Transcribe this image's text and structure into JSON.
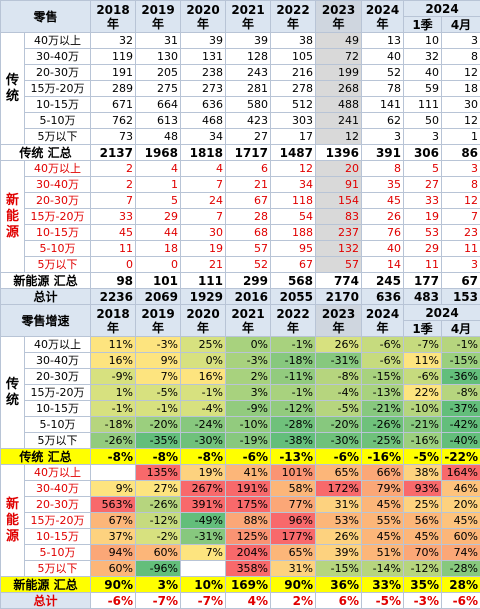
{
  "retail": {
    "header": {
      "label": "零售",
      "years": [
        "2018年",
        "2019年",
        "2020年",
        "2021年",
        "2022年",
        "2023年",
        "2024年"
      ],
      "group2024": "2024",
      "sub": [
        "1季",
        "4月"
      ]
    },
    "traditional": {
      "group_label": "传统",
      "rows": [
        {
          "label": "40万以上",
          "values": [
            "32",
            "31",
            "39",
            "39",
            "38",
            "49",
            "13",
            "10",
            "3"
          ]
        },
        {
          "label": "30-40万",
          "values": [
            "119",
            "130",
            "131",
            "128",
            "105",
            "72",
            "40",
            "32",
            "8"
          ]
        },
        {
          "label": "20-30万",
          "values": [
            "191",
            "205",
            "238",
            "243",
            "216",
            "199",
            "52",
            "40",
            "12"
          ]
        },
        {
          "label": "15万-20万",
          "values": [
            "289",
            "275",
            "273",
            "281",
            "278",
            "268",
            "78",
            "59",
            "18"
          ]
        },
        {
          "label": "10-15万",
          "values": [
            "671",
            "664",
            "636",
            "580",
            "512",
            "488",
            "141",
            "111",
            "30"
          ]
        },
        {
          "label": "5-10万",
          "values": [
            "762",
            "613",
            "468",
            "423",
            "303",
            "241",
            "62",
            "50",
            "12"
          ]
        },
        {
          "label": "5万以下",
          "values": [
            "73",
            "48",
            "34",
            "27",
            "17",
            "12",
            "3",
            "3",
            "1"
          ]
        }
      ],
      "sum": {
        "label": "传统 汇总",
        "values": [
          "2137",
          "1968",
          "1818",
          "1717",
          "1487",
          "1396",
          "391",
          "306",
          "86"
        ]
      }
    },
    "nev": {
      "group_label": "新能源",
      "rows": [
        {
          "label": "40万以上",
          "values": [
            "2",
            "4",
            "4",
            "6",
            "12",
            "20",
            "8",
            "5",
            "3"
          ]
        },
        {
          "label": "30-40万",
          "values": [
            "2",
            "1",
            "7",
            "21",
            "34",
            "91",
            "35",
            "27",
            "8"
          ]
        },
        {
          "label": "20-30万",
          "values": [
            "7",
            "5",
            "24",
            "67",
            "118",
            "154",
            "45",
            "33",
            "12"
          ]
        },
        {
          "label": "15万-20万",
          "values": [
            "33",
            "29",
            "7",
            "28",
            "54",
            "83",
            "26",
            "19",
            "7"
          ]
        },
        {
          "label": "10-15万",
          "values": [
            "45",
            "44",
            "30",
            "68",
            "188",
            "237",
            "76",
            "53",
            "23"
          ]
        },
        {
          "label": "5-10万",
          "values": [
            "11",
            "18",
            "19",
            "57",
            "95",
            "132",
            "40",
            "29",
            "11"
          ]
        },
        {
          "label": "5万以下",
          "values": [
            "0",
            "0",
            "21",
            "52",
            "67",
            "57",
            "14",
            "11",
            "3"
          ]
        }
      ],
      "sum": {
        "label": "新能源 汇总",
        "values": [
          "98",
          "101",
          "111",
          "299",
          "568",
          "774",
          "245",
          "177",
          "67"
        ]
      }
    },
    "total": {
      "label": "总计",
      "values": [
        "2236",
        "2069",
        "1929",
        "2016",
        "2055",
        "2170",
        "636",
        "483",
        "153"
      ]
    }
  },
  "growth": {
    "header": {
      "label": "零售增速",
      "years": [
        "2018年",
        "2019年",
        "2020年",
        "2021年",
        "2022年",
        "2023年",
        "2024年"
      ],
      "group2024": "2024",
      "sub": [
        "1季",
        "4月"
      ]
    },
    "traditional": {
      "group_label": "传统",
      "rows": [
        {
          "label": "40万以上",
          "values": [
            "11%",
            "-3%",
            "25%",
            "0%",
            "-1%",
            "26%",
            "-6%",
            "-7%",
            "-1%"
          ],
          "colors": [
            "#fde47f",
            "#fde47f",
            "#d7e17f",
            "#a8d27e",
            "#a8d27e",
            "#d7e17f",
            "#c6db7e",
            "#c6db7e",
            "#b6d57e"
          ]
        },
        {
          "label": "30-40万",
          "values": [
            "16%",
            "9%",
            "0%",
            "-3%",
            "-18%",
            "-31%",
            "-6%",
            "11%",
            "-15%"
          ],
          "colors": [
            "#fde47f",
            "#fde47f",
            "#d7e17f",
            "#a8d27e",
            "#87c87e",
            "#87c87e",
            "#c6db7e",
            "#fde47f",
            "#9bcf7e"
          ]
        },
        {
          "label": "20-30万",
          "values": [
            "-9%",
            "7%",
            "16%",
            "2%",
            "-11%",
            "-8%",
            "-15%",
            "-6%",
            "-36%"
          ],
          "colors": [
            "#d7e17f",
            "#fde47f",
            "#fde47f",
            "#a8d27e",
            "#92cb7e",
            "#b6d57e",
            "#a8d27e",
            "#c6db7e",
            "#63be7b"
          ]
        },
        {
          "label": "15万-20万",
          "values": [
            "1%",
            "-5%",
            "-1%",
            "3%",
            "-1%",
            "-4%",
            "-13%",
            "22%",
            "-8%"
          ],
          "colors": [
            "#d7e17f",
            "#d7e17f",
            "#d7e17f",
            "#a8d27e",
            "#a8d27e",
            "#b6d57e",
            "#a8d27e",
            "#fde47f",
            "#b6d57e"
          ]
        },
        {
          "label": "10-15万",
          "values": [
            "-1%",
            "-1%",
            "-4%",
            "-9%",
            "-12%",
            "-5%",
            "-21%",
            "-10%",
            "-37%"
          ],
          "colors": [
            "#d7e17f",
            "#d7e17f",
            "#d7e17f",
            "#92cb7e",
            "#92cb7e",
            "#b6d57e",
            "#87c87e",
            "#b6d57e",
            "#63be7b"
          ]
        },
        {
          "label": "5-10万",
          "values": [
            "-18%",
            "-20%",
            "-24%",
            "-10%",
            "-28%",
            "-20%",
            "-26%",
            "-21%",
            "-42%"
          ],
          "colors": [
            "#b6d57e",
            "#9bcf7e",
            "#87c87e",
            "#92cb7e",
            "#6fc17b",
            "#87c87e",
            "#6fc17b",
            "#87c87e",
            "#63be7b"
          ]
        },
        {
          "label": "5万以下",
          "values": [
            "-26%",
            "-35%",
            "-30%",
            "-19%",
            "-38%",
            "-30%",
            "-25%",
            "-16%",
            "-40%"
          ],
          "colors": [
            "#92cb7e",
            "#63be7b",
            "#6fc17b",
            "#87c87e",
            "#63be7b",
            "#6fc17b",
            "#6fc17b",
            "#9bcf7e",
            "#63be7b"
          ]
        }
      ],
      "sum": {
        "label": "传统 汇总",
        "values": [
          "-8%",
          "-8%",
          "-8%",
          "-6%",
          "-13%",
          "-6%",
          "-16%",
          "-5%",
          "-22%"
        ]
      }
    },
    "nev": {
      "group_label": "新能源",
      "rows": [
        {
          "label": "40万以上",
          "values": [
            "",
            "135%",
            "19%",
            "41%",
            "101%",
            "65%",
            "66%",
            "38%",
            "164%"
          ],
          "colors": [
            "#ffffff",
            "#f8696b",
            "#fdd27f",
            "#fcb679",
            "#fa9473",
            "#fcb679",
            "#fba777",
            "#fdd27f",
            "#f8696b"
          ]
        },
        {
          "label": "30-40万",
          "values": [
            "9%",
            "27%",
            "267%",
            "191%",
            "58%",
            "172%",
            "79%",
            "93%",
            "46%"
          ],
          "colors": [
            "#fde47f",
            "#fde47f",
            "#f8696b",
            "#f8696b",
            "#fcb679",
            "#f8696b",
            "#fba777",
            "#f8696b",
            "#fdc37d"
          ]
        },
        {
          "label": "20-30万",
          "values": [
            "563%",
            "-26%",
            "391%",
            "175%",
            "77%",
            "31%",
            "45%",
            "25%",
            "20%"
          ],
          "colors": [
            "#f8696b",
            "#b6d57e",
            "#f8696b",
            "#f8696b",
            "#fba777",
            "#fdd27f",
            "#fcb679",
            "#fdd27f",
            "#fdd27f"
          ]
        },
        {
          "label": "15万-20万",
          "values": [
            "67%",
            "-12%",
            "-49%",
            "88%",
            "96%",
            "53%",
            "55%",
            "56%",
            "45%"
          ],
          "colors": [
            "#fcb679",
            "#c6db7e",
            "#63be7b",
            "#fba777",
            "#f8696b",
            "#fcb679",
            "#fcb679",
            "#fcb679",
            "#fdc37d"
          ]
        },
        {
          "label": "10-15万",
          "values": [
            "37%",
            "-2%",
            "-31%",
            "125%",
            "177%",
            "26%",
            "45%",
            "45%",
            "60%"
          ],
          "colors": [
            "#fdd27f",
            "#d7e17f",
            "#87c87e",
            "#fa9473",
            "#f8696b",
            "#fdd27f",
            "#fcb679",
            "#fcb679",
            "#fcb679"
          ]
        },
        {
          "label": "5-10万",
          "values": [
            "94%",
            "60%",
            "7%",
            "204%",
            "65%",
            "39%",
            "51%",
            "70%",
            "74%"
          ],
          "colors": [
            "#fba777",
            "#fcb679",
            "#fde47f",
            "#f8696b",
            "#fcb679",
            "#fdd27f",
            "#fcb679",
            "#fba777",
            "#fba777"
          ]
        },
        {
          "label": "5万以下",
          "values": [
            "60%",
            "-96%",
            "",
            "358%",
            "31%",
            "-15%",
            "-14%",
            "-12%",
            "-28%"
          ],
          "colors": [
            "#fcb679",
            "#63be7b",
            "#ffffff",
            "#f8696b",
            "#fdd27f",
            "#b6d57e",
            "#b6d57e",
            "#b6d57e",
            "#87c87e"
          ]
        }
      ],
      "sum": {
        "label": "新能源 汇总",
        "values": [
          "90%",
          "3%",
          "10%",
          "169%",
          "90%",
          "36%",
          "33%",
          "35%",
          "28%"
        ]
      }
    },
    "total": {
      "label": "总计",
      "values": [
        "-6%",
        "-7%",
        "-7%",
        "4%",
        "2%",
        "6%",
        "-5%",
        "-3%",
        "-6%"
      ]
    }
  }
}
